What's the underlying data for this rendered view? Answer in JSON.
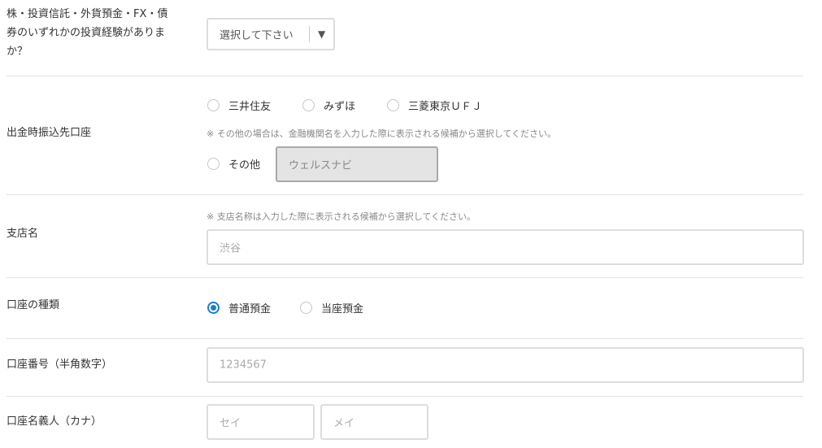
{
  "investment_experience": {
    "label_line1": "株・投資信託・外貨預金・FX・債",
    "label_line2": "券のいずれかの投資経験がありま",
    "label_line3": "か？",
    "select_value": "選択して下さい",
    "arrow": "▼"
  },
  "bank_account": {
    "label": "出金時振込先口座",
    "options": [
      "三井住友",
      "みずほ",
      "三菱東京ＵＦＪ"
    ],
    "note": "※ その他の場合は、金融機関名を入力した際に表示される候補から選択してください。",
    "other_label": "その他",
    "other_value": "ウェルスナビ"
  },
  "branch": {
    "label": "支店名",
    "note": "※ 支店名称は入力した際に表示される候補から選択してください。",
    "value": "渋谷"
  },
  "account_type": {
    "label": "口座の種類",
    "options": [
      "普通預金",
      "当座預金"
    ],
    "selected": "普通預金"
  },
  "account_number": {
    "label": "口座番号（半角数字）",
    "value": "1234567"
  },
  "account_holder": {
    "label": "口座名義人（カナ）",
    "first_placeholder": "セイ",
    "last_placeholder": "メイ"
  },
  "colors": {
    "accent": "#1a7fc1",
    "border": "#dddddd",
    "divider": "#e2e2e2"
  }
}
